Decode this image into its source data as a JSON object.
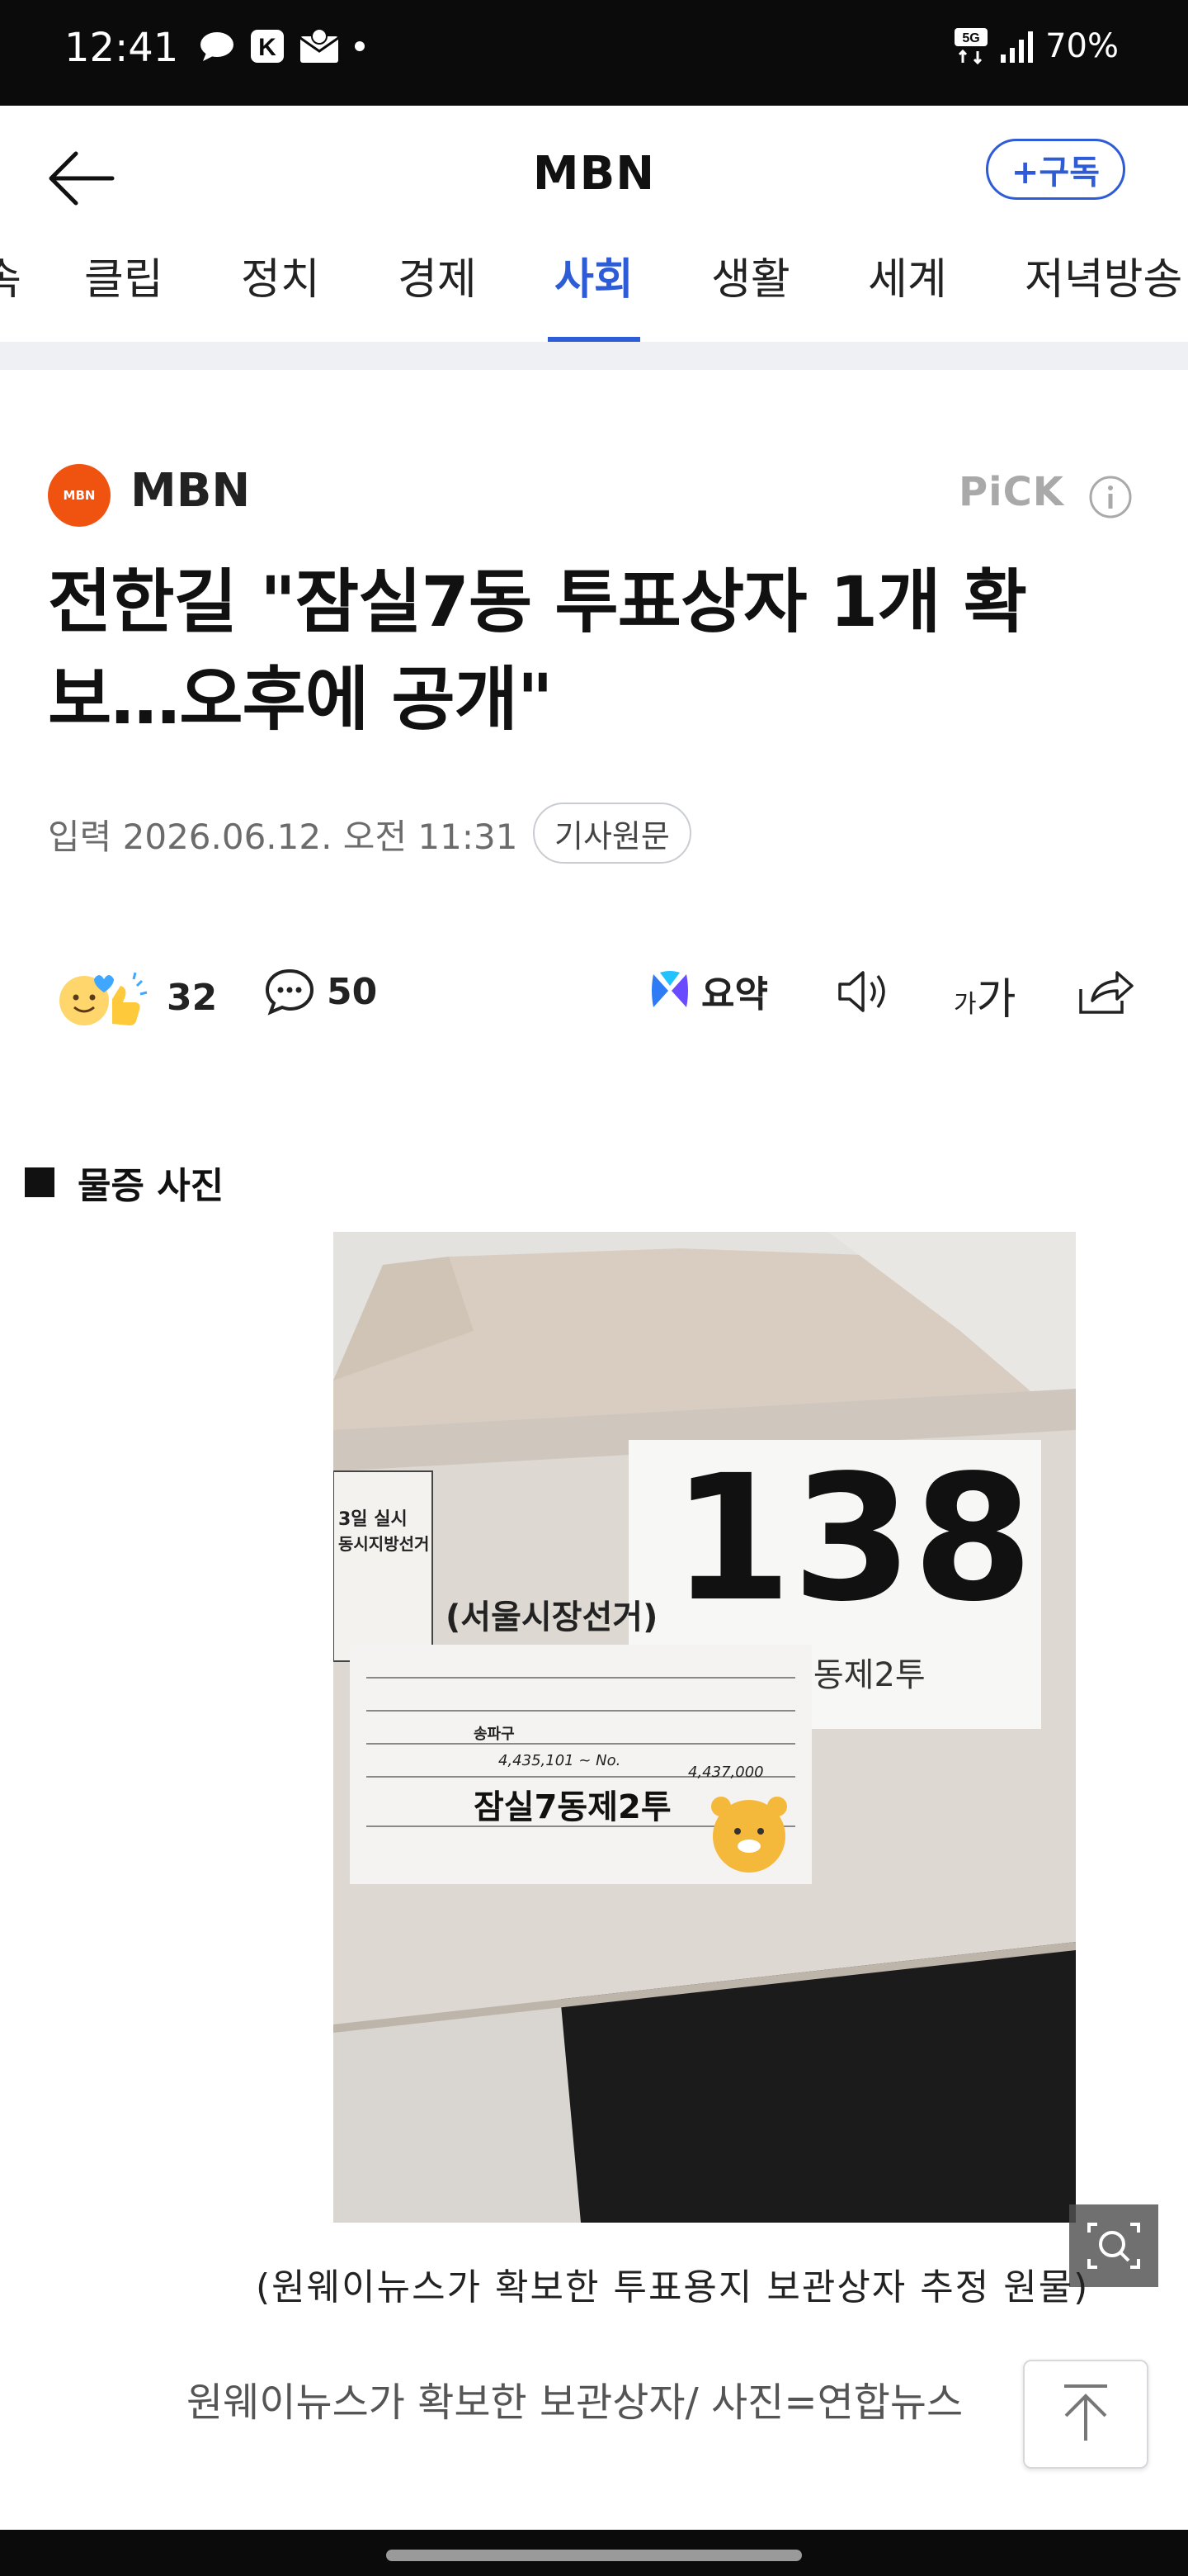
{
  "status_bar": {
    "time": "12:41",
    "network": "5G",
    "battery": "70%"
  },
  "header": {
    "title": "MBN",
    "subscribe_label": "+구독"
  },
  "tabs": [
    {
      "label": "속"
    },
    {
      "label": "클립"
    },
    {
      "label": "정치"
    },
    {
      "label": "경제"
    },
    {
      "label": "사회",
      "active": true
    },
    {
      "label": "생활"
    },
    {
      "label": "세계"
    },
    {
      "label": "저녁방송"
    }
  ],
  "article": {
    "press_logo_text": "MBN",
    "press_name": "MBN",
    "pick_label": "PiCK",
    "headline": "전한길 \"잠실7동 투표상자 1개 확보…오후에 공개\"",
    "date_line": "입력 2026.06.12. 오전 11:31",
    "original_button": "기사원문",
    "reactions_count": "32",
    "comments_count": "50",
    "summary_label": "요약",
    "font_size_label_small": "가",
    "font_size_label_large": "가",
    "section_label": "물증 사진",
    "photo": {
      "box_number": "138",
      "label_small": "(시장)잠실7동제2투",
      "label_mid": "(서울시장선거)",
      "stamp_top": "3일 실시",
      "stamp_bottom": "동시지방선거",
      "area_main": "잠실7동제2투",
      "district": "송파구",
      "range_start": "4,435,101 ~ No.",
      "range_end": "4,437,000"
    },
    "photo_caption": "(원웨이뉴스가 확보한 투표용지 보관상자 추정 원물)",
    "credit": "원웨이뉴스가 확보한 보관상자/ 사진=연합뉴스"
  },
  "colors": {
    "accent": "#2e5bd6",
    "press_logo": "#f0520f",
    "status_bar": "#0b0b0b"
  }
}
